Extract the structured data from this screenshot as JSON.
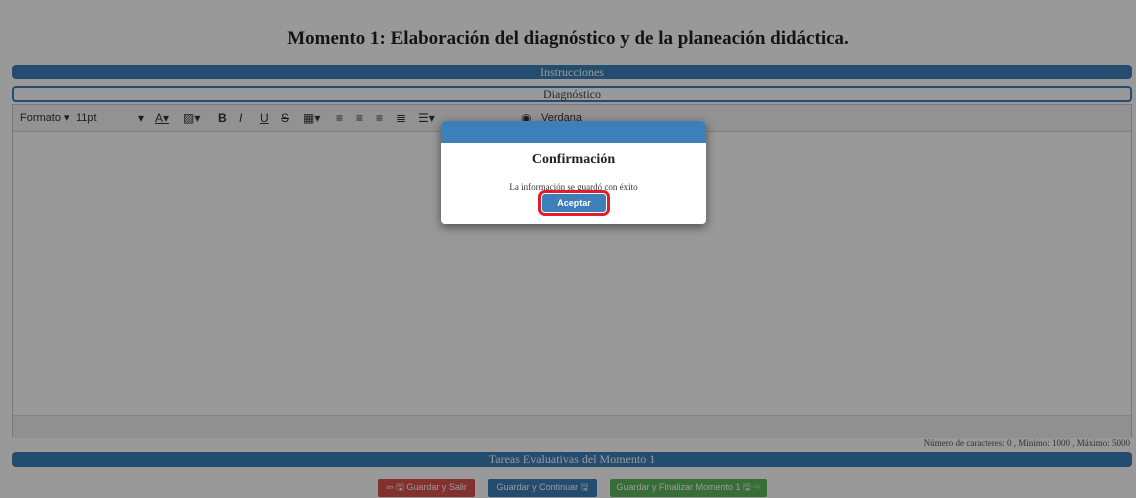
{
  "page_title": "Momento 1: Elaboración del diagnóstico y de la planeación didáctica.",
  "instructions_bar": "Instrucciones",
  "diagnostic_bar": "Diagnóstico",
  "toolbar": {
    "format_label": "Formato",
    "size_label": "11pt",
    "font_label": "Verdana"
  },
  "counter": "Número de caracteres: 0 , Mínimo: 1000 , Máximo: 5000",
  "tasks_bar": "Tareas Evaluativas del Momento 1",
  "actions": {
    "save_exit": "Guardar y Salir",
    "save_continue": "Guardar y Continuar",
    "save_finish": "Guardar y Finalizar Momento 1"
  },
  "modal": {
    "title": "Confirmación",
    "message": "La información se guardó con éxito",
    "button": "Aceptar"
  },
  "colors": {
    "accent": "#3c7fba",
    "danger": "#d9534f",
    "success": "#5cb85c",
    "highlight": "#e01e2b"
  }
}
